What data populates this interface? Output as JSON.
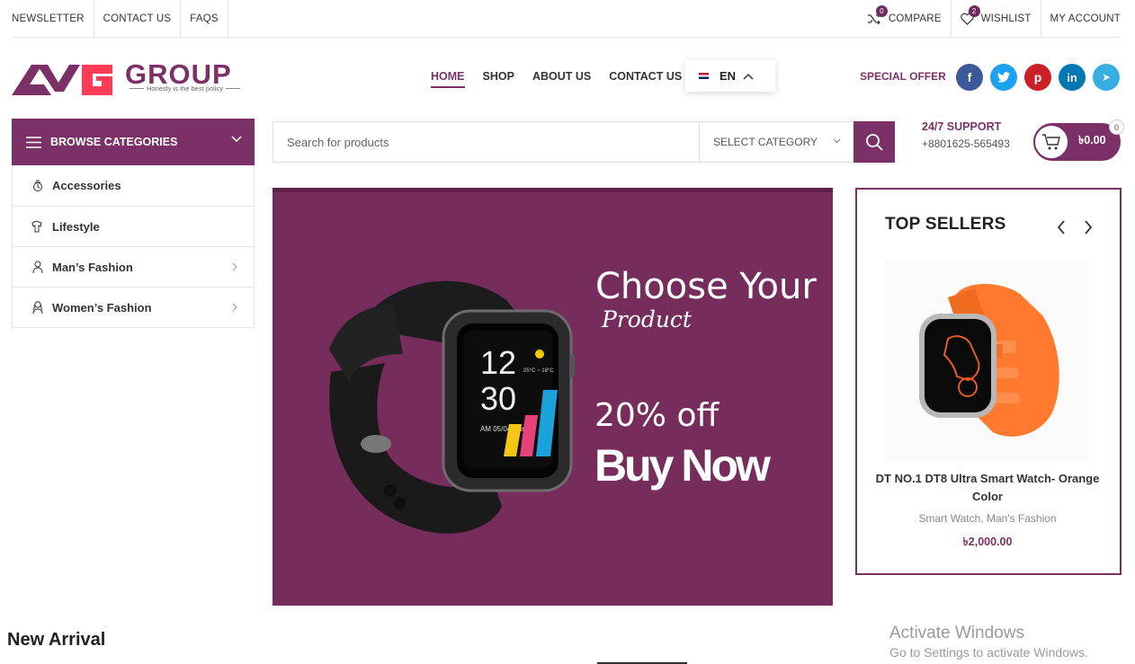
{
  "topbar": {
    "left_links": [
      "NEWSLETTER",
      "CONTACT US",
      "FAQS"
    ],
    "compare": {
      "label": "COMPARE",
      "count": "0",
      "icon": "shuffle-icon"
    },
    "wishlist": {
      "label": "WISHLIST",
      "count": "2",
      "icon": "heart-icon"
    },
    "account": "MY ACCOUNT"
  },
  "logo": {
    "brand": "GROUP",
    "tagline": "Honesty is the best policy"
  },
  "nav": {
    "items": [
      "HOME",
      "SHOP",
      "ABOUT US",
      "CONTACT US"
    ],
    "active": "HOME"
  },
  "language": {
    "code": "EN"
  },
  "special_offer": "SPECIAL OFFER",
  "social": [
    {
      "name": "facebook",
      "glyph": "f",
      "color": "#3b5998"
    },
    {
      "name": "twitter",
      "glyph": "t",
      "color": "#1da1f2"
    },
    {
      "name": "pinterest",
      "glyph": "p",
      "color": "#cb2027"
    },
    {
      "name": "linkedin",
      "glyph": "in",
      "color": "#0077b5"
    },
    {
      "name": "telegram",
      "glyph": "➤",
      "color": "#37aee2"
    }
  ],
  "browse": {
    "title": "BROWSE CATEGORIES",
    "categories": [
      {
        "label": "Accessories",
        "has_sub": false
      },
      {
        "label": "Lifestyle",
        "has_sub": false
      },
      {
        "label": "Man’s Fashion",
        "has_sub": true
      },
      {
        "label": "Women’s Fashion",
        "has_sub": true
      }
    ]
  },
  "search": {
    "placeholder": "Search for products",
    "category": "SELECT CATEGORY"
  },
  "support": {
    "title": "24/7 SUPPORT",
    "phone": "+8801625-565493"
  },
  "cart": {
    "amount": "৳0.00",
    "count": "0"
  },
  "hero": {
    "line1": "Choose Your",
    "line2": "Product",
    "line3": "20% off",
    "line4": "Buy Now",
    "watch_time_h": "12",
    "watch_time_m": "30",
    "watch_date": "AM 05/04 Sun",
    "watch_temp": "25°C ~ 18°C"
  },
  "top_sellers": {
    "title": "TOP SELLERS",
    "product": {
      "name": "DT NO.1 DT8 Ultra Smart Watch- Orange Color",
      "categories": "Smart Watch, Man's Fashion",
      "price": "৳2,000.00"
    }
  },
  "section_title": "New Arrival",
  "watermark": {
    "line1": "Activate Windows",
    "line2": "Go to Settings to activate Windows."
  },
  "colors": {
    "brand": "#7b3167",
    "hero_bg": "#772d5c"
  }
}
